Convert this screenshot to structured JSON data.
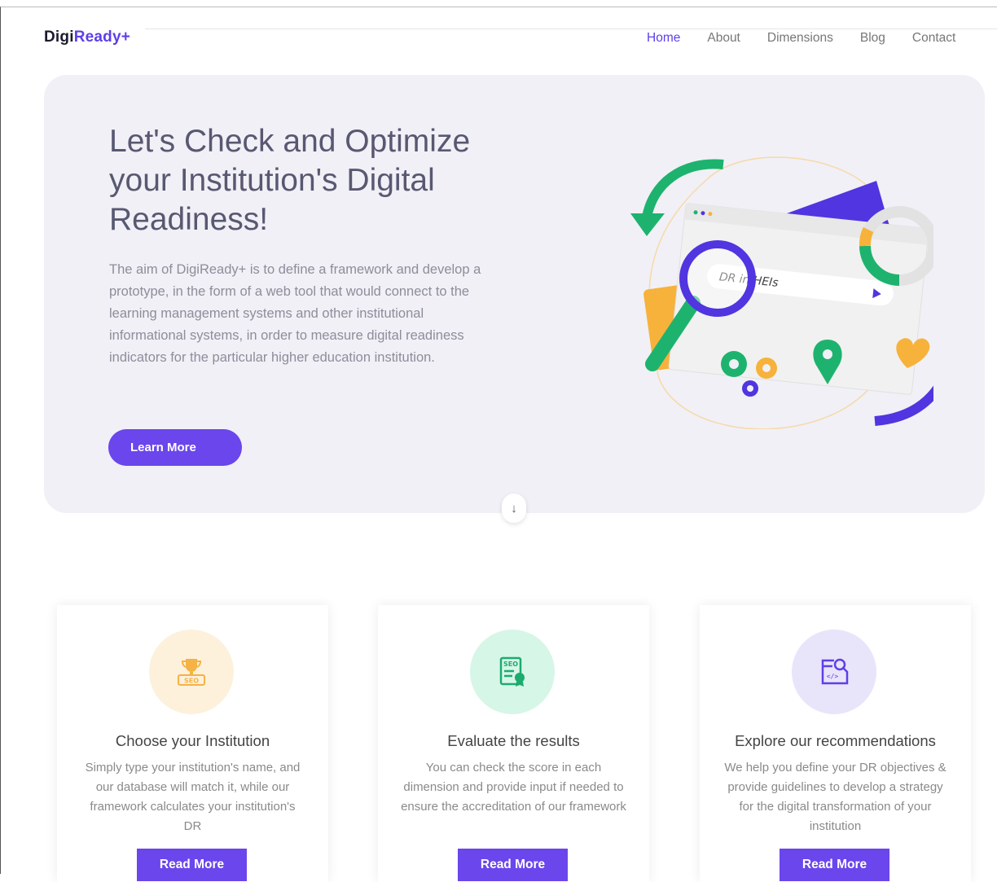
{
  "header": {
    "logo_main": "Digi",
    "logo_accent": "Ready+",
    "nav": [
      {
        "label": "Home",
        "active": true
      },
      {
        "label": "About"
      },
      {
        "label": "Dimensions"
      },
      {
        "label": "Blog"
      },
      {
        "label": "Contact"
      }
    ]
  },
  "hero": {
    "title": "Let's Check and Optimize your Institution's Digital Readiness!",
    "description": "The aim of DigiReady+ is to define a framework and develop a prototype, in the form of a web tool that would connect to the learning management systems and other institutional informational systems, in order to measure digital readiness indicators for the particular higher education institution.",
    "button_label": "Learn More",
    "illustration_search_text": "DR in HEIs",
    "scroll_icon": "arrow-down-icon"
  },
  "features": [
    {
      "icon": "trophy-icon",
      "icon_label": "SEO",
      "icon_bg": "#fdf1dc",
      "icon_color": "#f5b245",
      "title": "Choose your Institution",
      "text": "Simply type your institution's name, and our database will match it, while our framework calculates your institution's DR",
      "button_label": "Read More"
    },
    {
      "icon": "seo-certificate-icon",
      "icon_label": "SEO",
      "icon_bg": "#d6f6e8",
      "icon_color": "#1dab6e",
      "title": "Evaluate the results",
      "text": "You can check the score in each dimension and provide input if needed to ensure the accreditation of our framework",
      "button_label": "Read More"
    },
    {
      "icon": "code-search-icon",
      "icon_label": "</>",
      "icon_bg": "#e8e5fb",
      "icon_color": "#5e3fe8",
      "title": "Explore our recommendations",
      "text": "We help you define your DR objectives & provide guidelines to develop a strategy for the digital transformation of your institution",
      "button_label": "Read More"
    }
  ],
  "colors": {
    "accent": "#6a46ec",
    "hero_bg": "#f1f0f6",
    "illustration_green": "#1db36e",
    "illustration_purple": "#5035e0",
    "illustration_orange": "#f7b23b"
  }
}
